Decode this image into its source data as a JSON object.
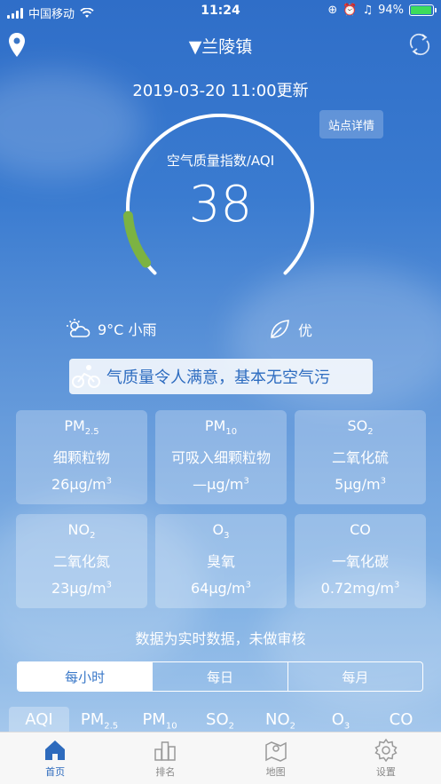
{
  "status_bar": {
    "carrier": "中国移动",
    "time": "11:24",
    "battery": "94%",
    "battery_level": 0.94
  },
  "header": {
    "title": "▼兰陵镇"
  },
  "updated": "2019-03-20 11:00更新",
  "station_button": "站点详情",
  "aqi": {
    "label": "空气质量指数/AQI",
    "value": "38",
    "gauge_fraction": 0.08,
    "accent": "#7cb342"
  },
  "weather": {
    "text": "9°C 小雨",
    "quality": "优"
  },
  "ticker": "气质量令人满意，基本无空气污",
  "pollutants": [
    {
      "name": "PM",
      "sub": "2.5",
      "cn": "细颗粒物",
      "value": "26μg/m",
      "unit_sup": "3"
    },
    {
      "name": "PM",
      "sub": "10",
      "cn": "可吸入细颗粒物",
      "value": "—μg/m",
      "unit_sup": "3"
    },
    {
      "name": "SO",
      "sub": "2",
      "cn": "二氧化硫",
      "value": "5μg/m",
      "unit_sup": "3"
    },
    {
      "name": "NO",
      "sub": "2",
      "cn": "二氧化氮",
      "value": "23μg/m",
      "unit_sup": "3"
    },
    {
      "name": "O",
      "sub": "3",
      "cn": "臭氧",
      "value": "64μg/m",
      "unit_sup": "3"
    },
    {
      "name": "CO",
      "sub": "",
      "cn": "一氧化碳",
      "value": "0.72mg/m",
      "unit_sup": "3"
    }
  ],
  "note": "数据为实时数据，未做审核",
  "period_tabs": [
    "每小时",
    "每日",
    "每月"
  ],
  "pollutant_tabs": [
    {
      "name": "AQI",
      "sub": ""
    },
    {
      "name": "PM",
      "sub": "2.5"
    },
    {
      "name": "PM",
      "sub": "10"
    },
    {
      "name": "SO",
      "sub": "2"
    },
    {
      "name": "NO",
      "sub": "2"
    },
    {
      "name": "O",
      "sub": "3"
    },
    {
      "name": "CO",
      "sub": ""
    }
  ],
  "tabbar": [
    {
      "label": "首页",
      "icon": "home-icon",
      "active": true
    },
    {
      "label": "排名",
      "icon": "ranking-icon",
      "active": false
    },
    {
      "label": "地图",
      "icon": "map-icon",
      "active": false
    },
    {
      "label": "设置",
      "icon": "gear-icon",
      "active": false
    }
  ]
}
